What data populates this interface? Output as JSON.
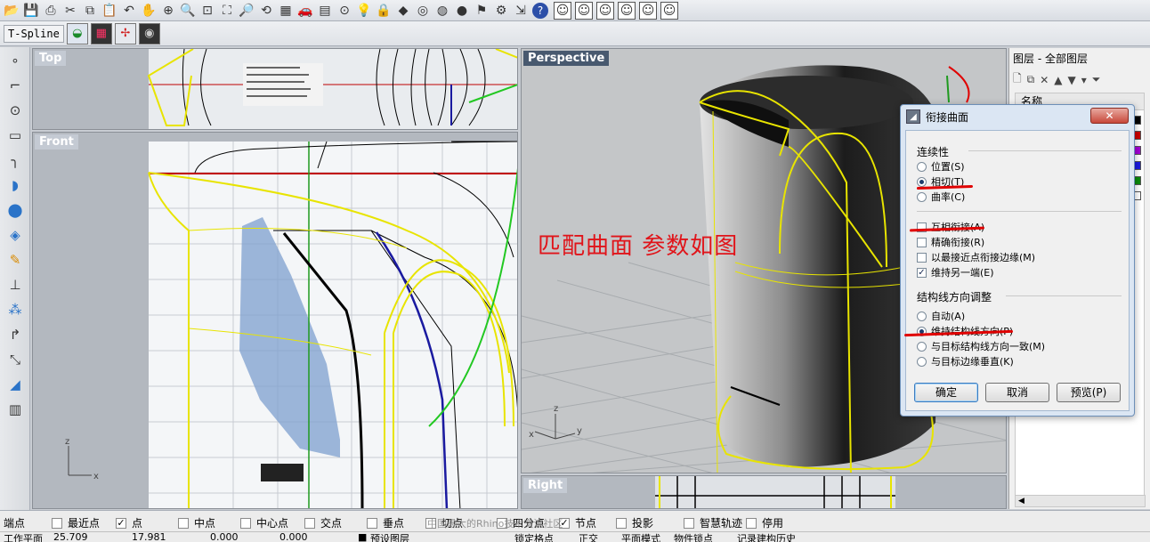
{
  "toolbar": {
    "icons": [
      "open-icon",
      "save-icon",
      "print-icon",
      "cut-icon",
      "copy-icon",
      "paste-icon",
      "undo-icon",
      "pan-icon",
      "rotate-view-icon",
      "zoom-icon",
      "zoom-window-icon",
      "zoom-extents-icon",
      "zoom-selected-icon",
      "rotate-icon",
      "grid-icon",
      "car-icon",
      "layout-icon",
      "snap-icon",
      "light-icon",
      "lock-icon",
      "material-icon",
      "color-wheel-icon",
      "sphere-wire-icon",
      "sphere-render-icon",
      "flag-icon",
      "gear-icon",
      "transform-icon",
      "help-icon"
    ],
    "tspline_label": "T-Spline"
  },
  "viewports": {
    "top": "Top",
    "front": "Front",
    "perspective": "Perspective",
    "right": "Right"
  },
  "annotation": "匹配曲面  参数如图",
  "layers": {
    "title": "图层 - 全部图层",
    "column_name": "名称",
    "swatch_colors": [
      "#000000",
      "#cc0000",
      "#a200d6",
      "#1a1ae0",
      "#0a8a0a",
      "#ffffff"
    ]
  },
  "dialog": {
    "title": "衔接曲面",
    "close_label": "✕",
    "continuity_group": "连续性",
    "continuity_options": [
      "位置(S)",
      "相切(T)",
      "曲率(C)"
    ],
    "continuity_selected": "相切(T)",
    "checkboxes": [
      {
        "label": "互相衔接(A)",
        "checked": false
      },
      {
        "label": "精确衔接(R)",
        "checked": false
      },
      {
        "label": "以最接近点衔接边缘(M)",
        "checked": false
      },
      {
        "label": "维持另一端(E)",
        "checked": true
      }
    ],
    "isocurve_group": "结构线方向调整",
    "isocurve_options": [
      "自动(A)",
      "维持结构线方向(P)",
      "与目标结构线方向一致(M)",
      "与目标边缘垂直(K)"
    ],
    "isocurve_selected": "维持结构线方向(P)",
    "ok_label": "确定",
    "cancel_label": "取消",
    "preview_label": "预览(P)"
  },
  "statusbar": {
    "osnaps": [
      {
        "label": "端点",
        "checked": false
      },
      {
        "label": "最近点",
        "checked": false
      },
      {
        "label": "点",
        "checked": true
      },
      {
        "label": "中点",
        "checked": false
      },
      {
        "label": "中心点",
        "checked": false
      },
      {
        "label": "交点",
        "checked": false
      },
      {
        "label": "垂点",
        "checked": false
      },
      {
        "label": "切点",
        "checked": false
      },
      {
        "label": "四分点",
        "checked": false
      },
      {
        "label": "节点",
        "checked": true
      },
      {
        "label": "投影",
        "checked": false
      },
      {
        "label": "智慧轨迹",
        "checked": false
      },
      {
        "label": "停用",
        "checked": false
      }
    ],
    "coords": [
      "25.709",
      "17.981",
      "0.000",
      "0.000"
    ],
    "bottom_items": [
      "工作平面",
      "预设图层",
      "锁定格点",
      "正交",
      "平面模式",
      "物件锁点",
      "记录建构历史"
    ]
  },
  "watermark": "中国最大的Rhino技术交流社区"
}
